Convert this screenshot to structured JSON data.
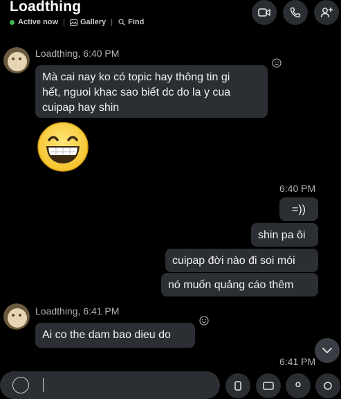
{
  "header": {
    "title": "Loadthing",
    "status": "Active now",
    "gallery": "Gallery",
    "find": "Find",
    "separator": "|"
  },
  "messages": {
    "m1": {
      "sender": "Loadthing, 6:40 PM",
      "lines": [
        "Mà cai nay ko có topic hay thông tin gi",
        "hết, nguoi khac sao biết dc do la y cua",
        "cuipap hay shin"
      ]
    },
    "emoji": "grinning",
    "mine_time": "6:40 PM",
    "mine": [
      "=))",
      "shin pa ôi",
      "cuipap đời nào đi soi mói",
      "nó muốn quảng cáo thêm"
    ],
    "m2": {
      "sender": "Loadthing, 6:41 PM",
      "text": "Ai co the dam bao dieu do"
    },
    "last_time": "6:41 PM"
  },
  "colors": {
    "background": "#000000",
    "bubble": "#2b2e33",
    "active": "#3fb950",
    "button": "#2a2e33"
  },
  "icons": [
    "video-call-icon",
    "phone-icon",
    "add-person-icon",
    "reaction-icon",
    "chevron-down-icon"
  ]
}
